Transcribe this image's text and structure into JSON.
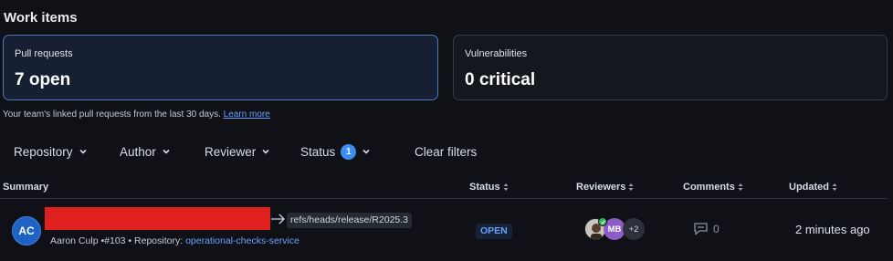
{
  "section_title": "Work items",
  "cards": [
    {
      "label": "Pull requests",
      "value": "7 open"
    },
    {
      "label": "Vulnerabilities",
      "value": "0 critical"
    }
  ],
  "note": {
    "text": "Your team's linked pull requests from the last 30 days.",
    "link": "Learn more"
  },
  "filters": {
    "repository": "Repository",
    "author": "Author",
    "reviewer": "Reviewer",
    "status": "Status",
    "status_count": "1",
    "clear": "Clear filters"
  },
  "table": {
    "headers": {
      "summary": "Summary",
      "status": "Status",
      "reviewers": "Reviewers",
      "comments": "Comments",
      "updated": "Updated"
    },
    "rows": [
      {
        "author_initials": "AC",
        "target_branch": "refs/heads/release/R2025.3",
        "author": "Aaron Culp",
        "pr_number": "#103",
        "repository_label": "Repository:",
        "repository": "operational-checks-service",
        "status": "OPEN",
        "reviewer2_initials": "MB",
        "reviewers_more": "+2",
        "comments": "0",
        "updated": "2 minutes ago"
      }
    ]
  },
  "colors": {
    "accent": "#3a8ef6",
    "link": "#6aa0ff",
    "redaction": "#e01f1f",
    "approved": "#2fb457"
  }
}
